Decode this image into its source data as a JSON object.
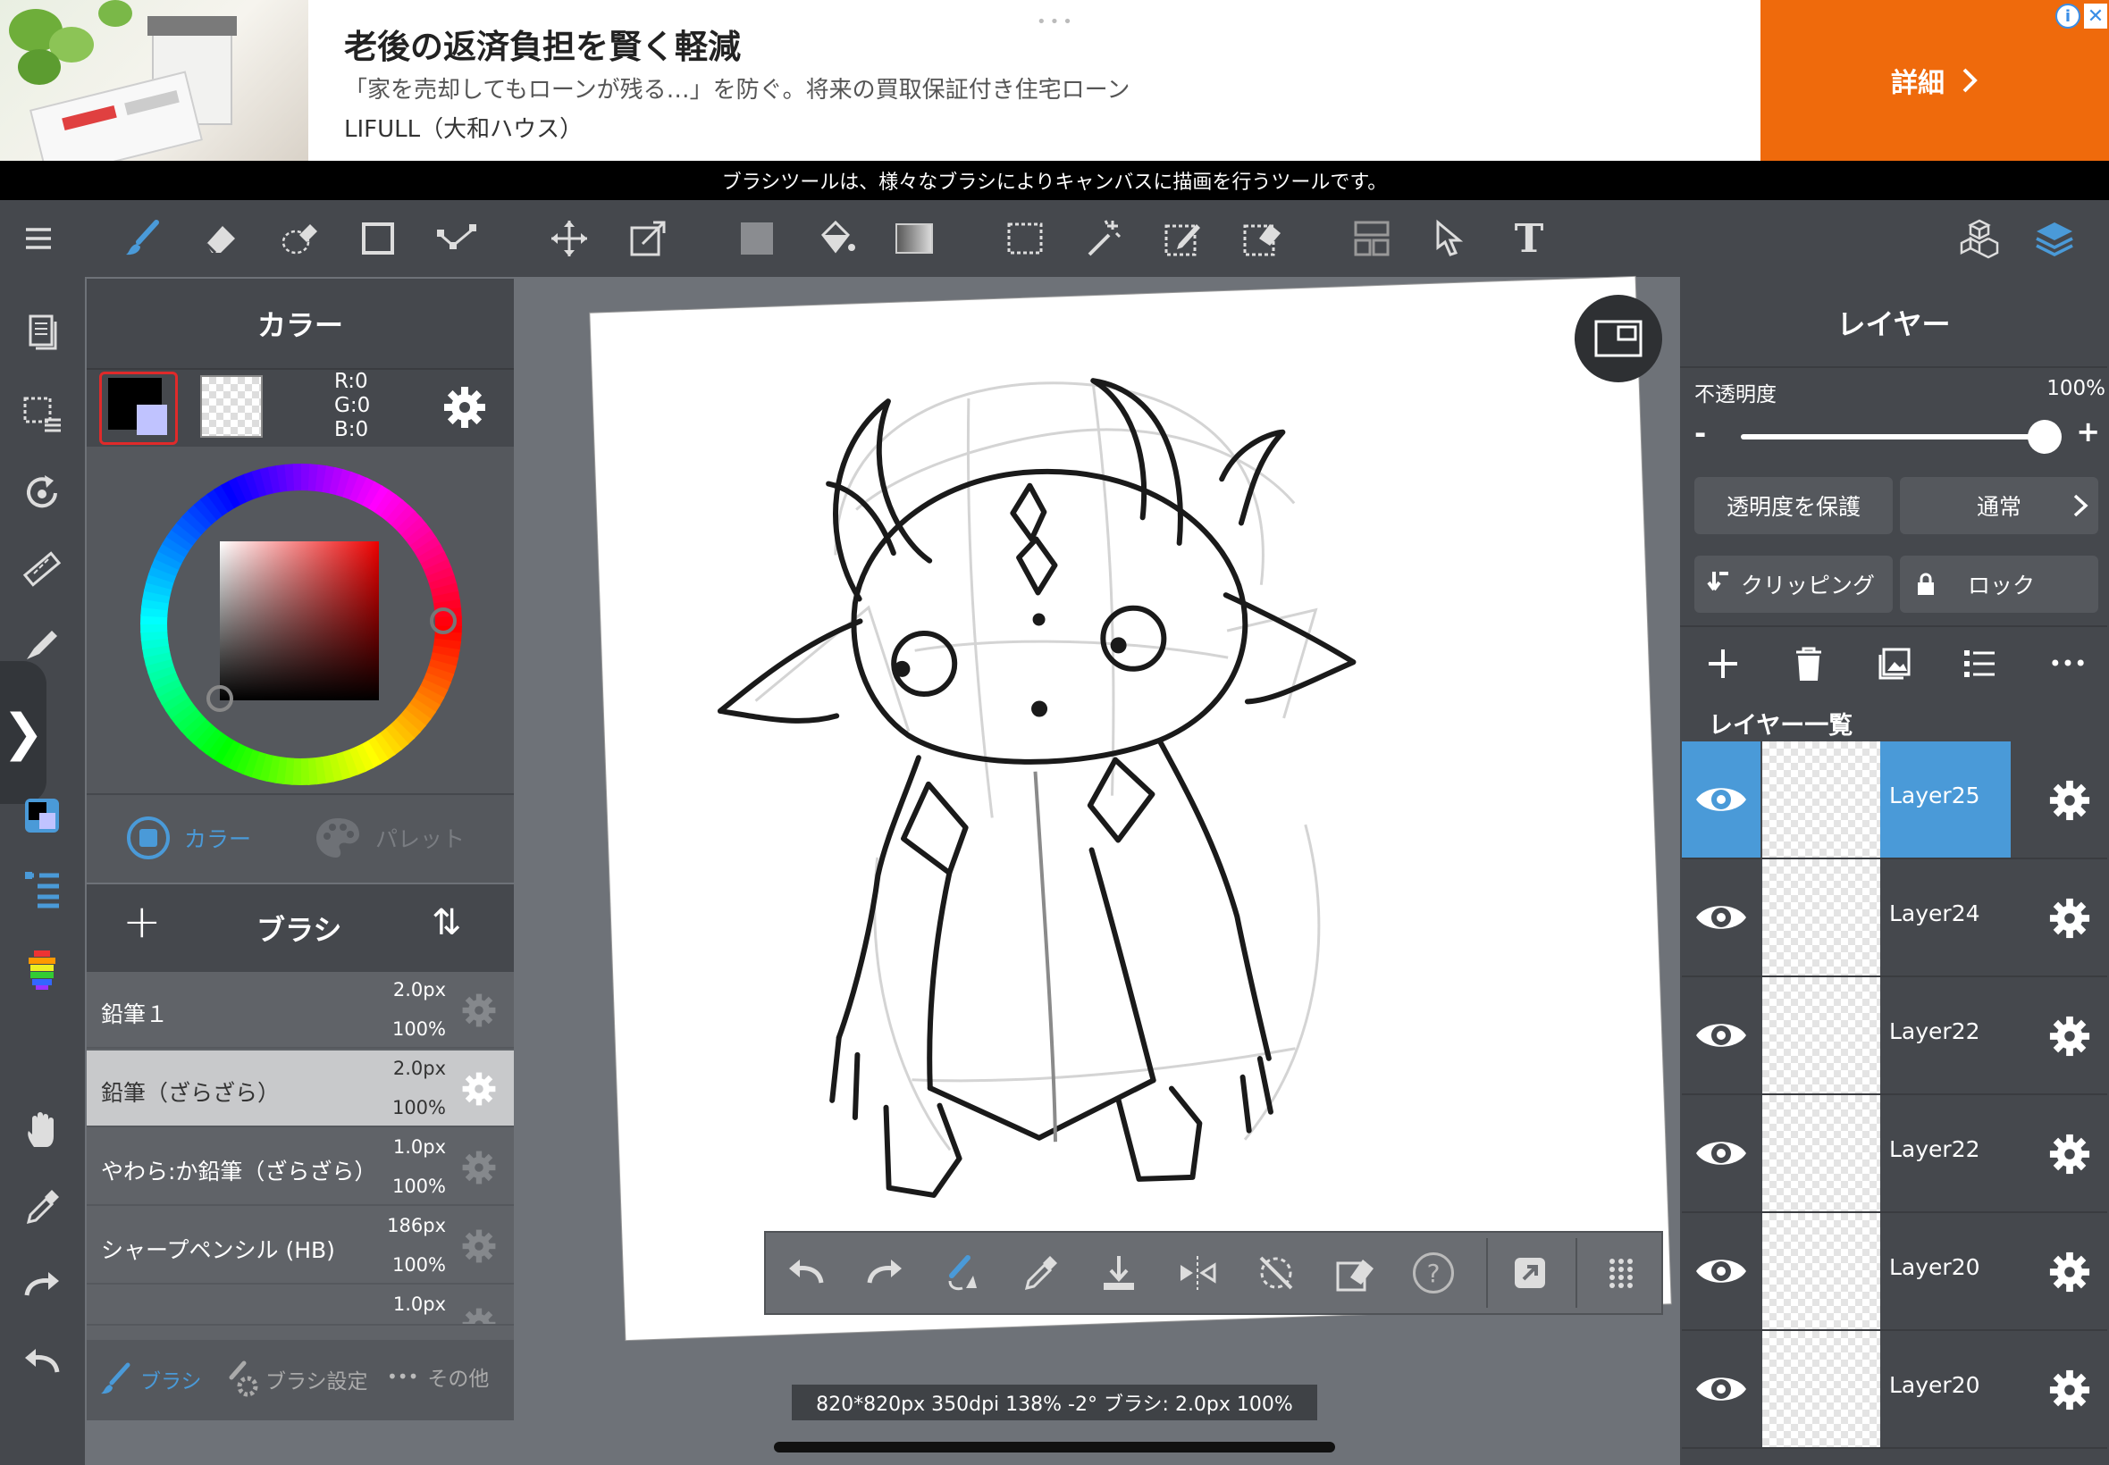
{
  "ad": {
    "title": "老後の返済負担を賢く軽減",
    "description": "「家を売却してもローンが残る…」を防ぐ。将来の買取保証付き住宅ローン",
    "brand": "LIFULL（大和ハウス）",
    "cta_label": "詳細",
    "info_icon": "i",
    "close_icon": "✕",
    "dots": "•••"
  },
  "tip": "ブラシツールは、様々なブラシによりキャンバスに描画を行うツールです。",
  "toolbar": {
    "icons": [
      "menu-icon",
      "brush-icon",
      "eraser-icon",
      "lasso-eraser-icon",
      "rectangle-icon",
      "dot-line-icon",
      "move-icon",
      "transform-icon",
      "fill-color-icon",
      "bucket-icon",
      "gradient-icon",
      "select-rect-icon",
      "magic-wand-icon",
      "select-pen-icon",
      "select-eraser-icon",
      "frame-divide-icon",
      "operation-icon",
      "text-icon",
      "3d-model-icon",
      "layers-icon"
    ],
    "text_tool_glyph": "T"
  },
  "left_tools": {
    "icons": [
      "page-icon",
      "selection-layer-icon",
      "rotate-icon",
      "ruler-icon",
      "pen-icon",
      "expand-icon",
      "color-swatch-icon",
      "brush-list-icon",
      "palette-bar-icon",
      "hand-icon",
      "eyedropper-icon",
      "redo-icon",
      "undo-icon"
    ],
    "expand_glyph": "❯"
  },
  "color_panel": {
    "title": "カラー",
    "r_label": "R:0",
    "g_label": "G:0",
    "b_label": "B:0",
    "tab_color": "カラー",
    "tab_palette": "パレット",
    "foreground_color": "#000000",
    "background_color": "transparent"
  },
  "brush_panel": {
    "title": "ブラシ",
    "add_glyph": "+",
    "sort_glyph": "⇅",
    "brushes": [
      {
        "name": "鉛筆１",
        "size": "2.0px",
        "opacity": "100%"
      },
      {
        "name": "鉛筆（ざらざら）",
        "size": "2.0px",
        "opacity": "100%",
        "selected": true
      },
      {
        "name": "やわら:か鉛筆（ざらざら）",
        "size": "1.0px",
        "opacity": "100%"
      },
      {
        "name": "シャープペンシル (HB)",
        "size": "186px",
        "opacity": "100%"
      },
      {
        "name": "",
        "size": "1.0px",
        "opacity": ""
      }
    ],
    "footer_brush": "ブラシ",
    "footer_settings": "ブラシ設定",
    "footer_other": "その他",
    "footer_other_dots": "•••"
  },
  "canvas": {
    "status": "820*820px 350dpi 138% -2° ブラシ: 2.0px 100%",
    "rotation_degrees": -2
  },
  "floatbar": {
    "icons": [
      "undo-icon",
      "redo-icon",
      "brush-switch-icon",
      "eyedropper-icon",
      "save-icon",
      "flip-icon",
      "rotate-reset-icon",
      "clear-icon",
      "help-icon",
      "share-icon",
      "grid-icon"
    ],
    "help_glyph": "?"
  },
  "layer_panel": {
    "title": "レイヤー",
    "opacity_label": "不透明度",
    "opacity_value": "100%",
    "opacity_fraction": 1.0,
    "minus": "-",
    "plus": "+",
    "protect_alpha": "透明度を保護",
    "blend_mode": "通常",
    "clipping": "クリッピング",
    "lock": "ロック",
    "list_title": "レイヤー一覧",
    "more_dots": "•••",
    "layers": [
      {
        "name": "Layer25",
        "selected": true
      },
      {
        "name": "Layer24"
      },
      {
        "name": "Layer22"
      },
      {
        "name": "Layer22"
      },
      {
        "name": "Layer20"
      },
      {
        "name": "Layer20"
      }
    ]
  },
  "colors": {
    "accent": "#4a9ad8",
    "ad_cta": "#ef6a0c",
    "panel": "#45484d",
    "workarea": "#6e7278"
  }
}
